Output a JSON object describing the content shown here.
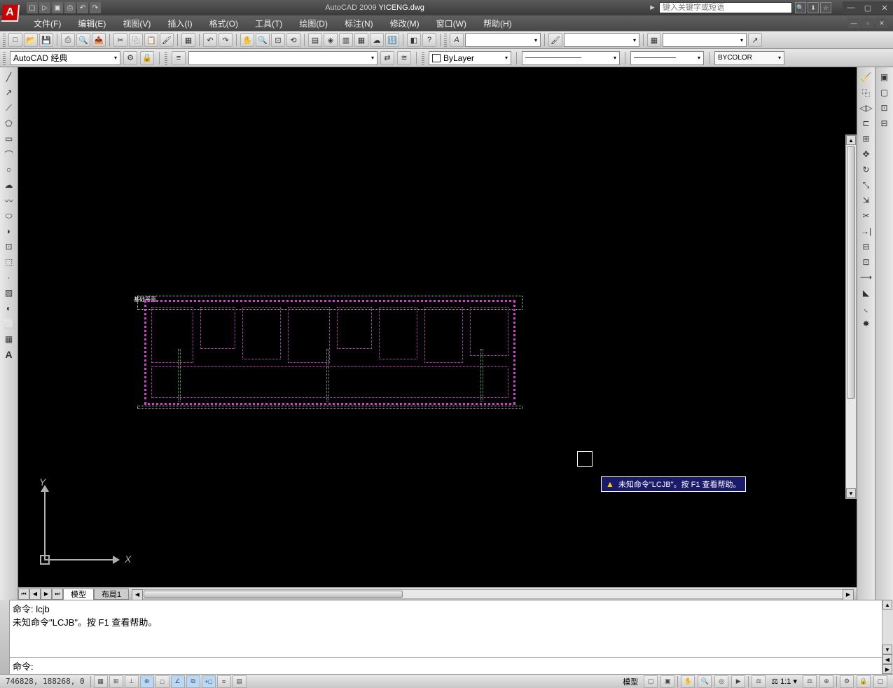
{
  "title": {
    "app": "AutoCAD 2009",
    "file": "YICENG.dwg",
    "search_placeholder": "键入关键字或短语"
  },
  "menubar": {
    "items": [
      "文件(F)",
      "编辑(E)",
      "视图(V)",
      "插入(I)",
      "格式(O)",
      "工具(T)",
      "绘图(D)",
      "标注(N)",
      "修改(M)",
      "窗口(W)",
      "帮助(H)"
    ]
  },
  "workspace": {
    "current": "AutoCAD 经典"
  },
  "properties": {
    "layer_color": "ByLayer",
    "plot_style": "BYCOLOR"
  },
  "tabs": {
    "model": "模型",
    "layout1": "布局1"
  },
  "drawing": {
    "label_top": "基础平面"
  },
  "cursor": {
    "tooltip": "未知命令\"LCJB\"。按 F1 查看帮助。"
  },
  "commandline": {
    "line1": "命令: lcjb",
    "line2": "未知命令\"LCJB\"。按 F1 查看帮助。",
    "prompt": "命令:"
  },
  "statusbar": {
    "coords": "746828, 188268, 0",
    "model_label": "模型",
    "scale": "1:1"
  },
  "ucs": {
    "x_label": "X",
    "y_label": "Y"
  },
  "play_icon": "►"
}
